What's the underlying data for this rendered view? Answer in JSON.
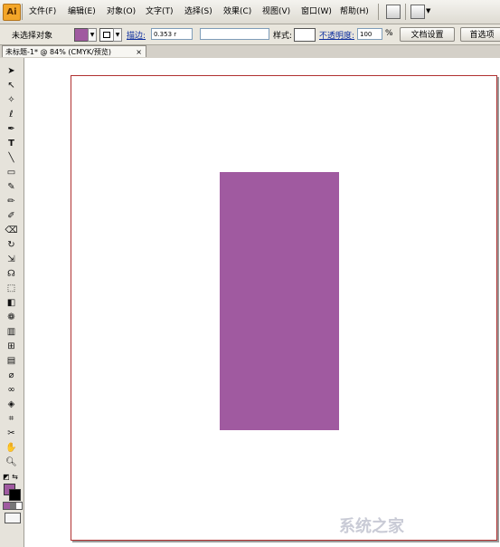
{
  "app": {
    "logo_text": "Ai"
  },
  "menu": {
    "items": [
      "文件(F)",
      "编辑(E)",
      "对象(O)",
      "文字(T)",
      "选择(S)",
      "效果(C)",
      "视图(V)",
      "窗口(W)",
      "帮助(H)"
    ]
  },
  "control_bar": {
    "selection_label": "未选择对象",
    "fill_color": "#a05aa0",
    "stroke_label": "描边:",
    "stroke_value": "0.353 r",
    "style_label": "样式:",
    "opacity_label": "不透明度:",
    "opacity_value": "100",
    "opacity_unit": "%",
    "doc_setup_button": "文档设置",
    "preferences_button": "首选项"
  },
  "tab": {
    "title": "未标题-1* @ 84% (CMYK/预览)",
    "close": "×"
  },
  "canvas": {
    "shape_color": "#a05aa0"
  },
  "watermark": {
    "text": "系统之家"
  }
}
